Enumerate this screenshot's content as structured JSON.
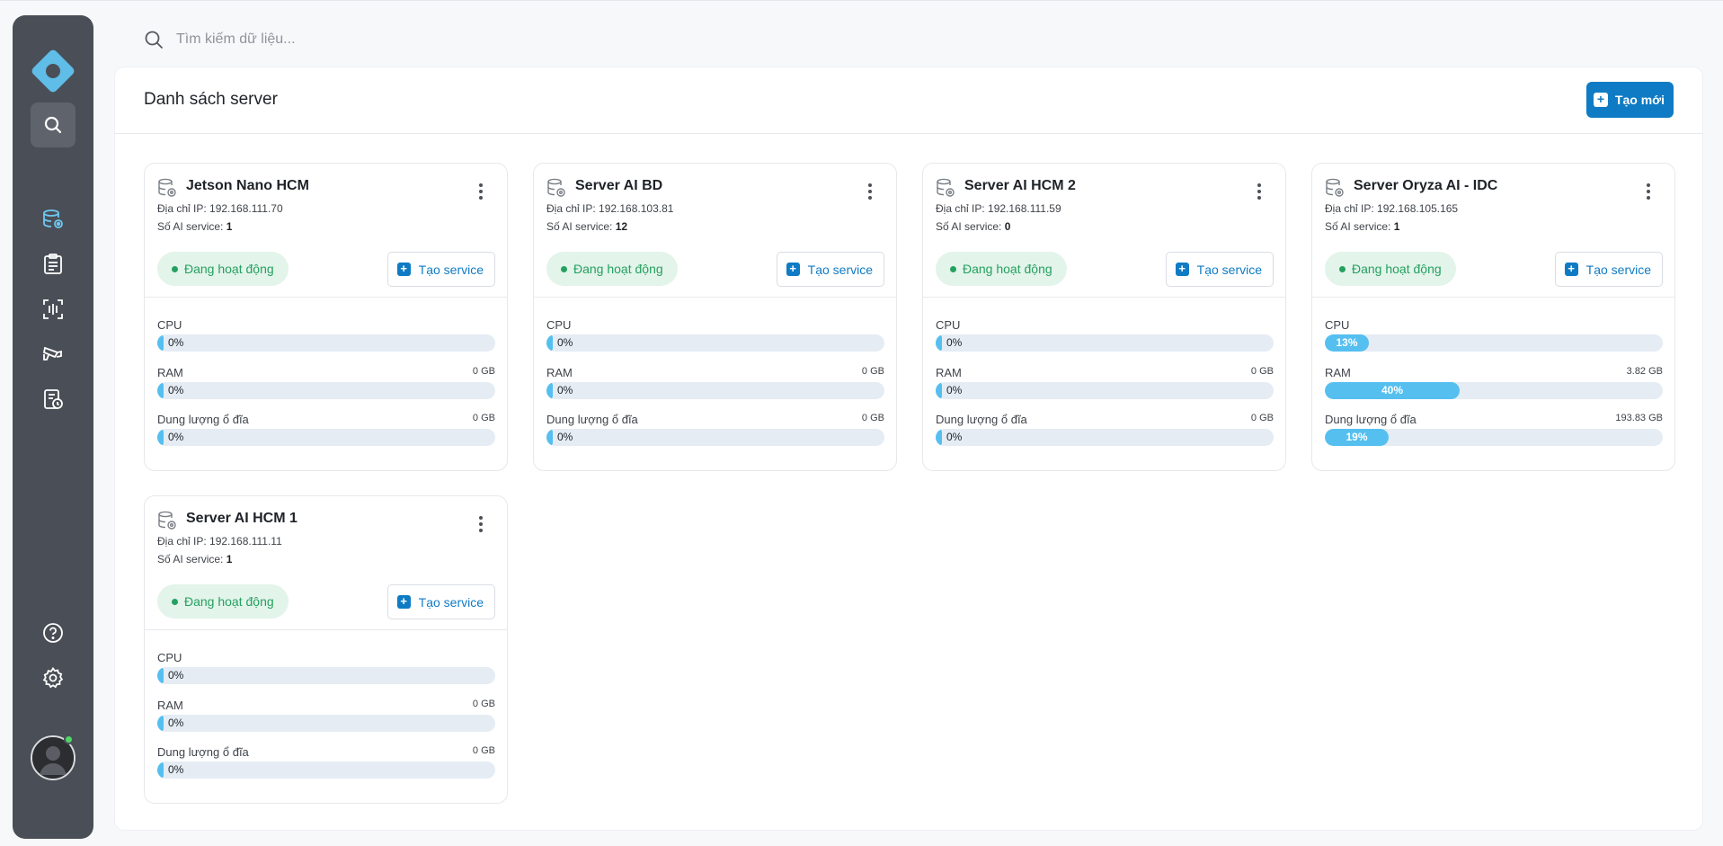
{
  "search": {
    "placeholder": "Tìm kiếm dữ liệu..."
  },
  "header": {
    "title": "Danh sách server",
    "new_button": "Tạo mới"
  },
  "labels": {
    "ip_prefix": "Địa chỉ IP: ",
    "svc_prefix": "Số AI service: ",
    "create_service": "Tạo service",
    "cpu": "CPU",
    "ram": "RAM",
    "disk": "Dung lượng ổ đĩa"
  },
  "servers": [
    {
      "name": "Jetson Nano HCM",
      "ip": "192.168.111.70",
      "services": "1",
      "status": "Đang hoạt động",
      "cpu_pct": 0,
      "cpu_text": "0%",
      "ram_pct": 0,
      "ram_text": "0%",
      "ram_size": "0 GB",
      "disk_pct": 0,
      "disk_text": "0%",
      "disk_size": "0 GB"
    },
    {
      "name": "Server AI BD",
      "ip": "192.168.103.81",
      "services": "12",
      "status": "Đang hoạt động",
      "cpu_pct": 0,
      "cpu_text": "0%",
      "ram_pct": 0,
      "ram_text": "0%",
      "ram_size": "0 GB",
      "disk_pct": 0,
      "disk_text": "0%",
      "disk_size": "0 GB"
    },
    {
      "name": "Server AI HCM 2",
      "ip": "192.168.111.59",
      "services": "0",
      "status": "Đang hoạt động",
      "cpu_pct": 0,
      "cpu_text": "0%",
      "ram_pct": 0,
      "ram_text": "0%",
      "ram_size": "0 GB",
      "disk_pct": 0,
      "disk_text": "0%",
      "disk_size": "0 GB"
    },
    {
      "name": "Server Oryza AI - IDC",
      "ip": "192.168.105.165",
      "services": "1",
      "status": "Đang hoạt động",
      "cpu_pct": 13,
      "cpu_text": "13%",
      "ram_pct": 40,
      "ram_text": "40%",
      "ram_size": "3.82 GB",
      "disk_pct": 19,
      "disk_text": "19%",
      "disk_size": "193.83 GB"
    },
    {
      "name": "Server AI HCM 1",
      "ip": "192.168.111.11",
      "services": "1",
      "status": "Đang hoạt động",
      "cpu_pct": 0,
      "cpu_text": "0%",
      "ram_pct": 0,
      "ram_text": "0%",
      "ram_size": "0 GB",
      "disk_pct": 0,
      "disk_text": "0%",
      "disk_size": "0 GB"
    }
  ],
  "colors": {
    "accent": "#0f7bc4",
    "bar_fill": "#55bff0",
    "bar_bg": "#e5ecf3",
    "status_green": "#25a060",
    "sidebar": "#4a4f57"
  },
  "sidebar_icons": [
    "logo-icon",
    "search-icon",
    "server-icon",
    "clipboard-icon",
    "face-scan-icon",
    "cctv-camera-icon",
    "report-icon",
    "help-icon",
    "gear-icon"
  ]
}
